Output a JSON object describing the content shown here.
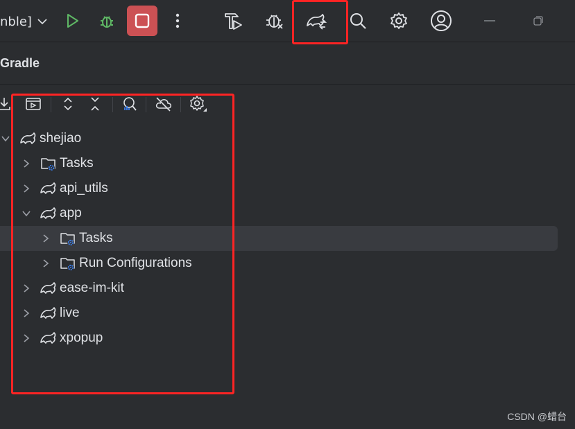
{
  "toolbar": {
    "run_config_label": "nble]",
    "icons": [
      "chevron-down-icon",
      "run-icon",
      "debug-icon",
      "stop-icon",
      "more-icon",
      "build-icon",
      "profile-icon",
      "gradle-sync-icon",
      "search-icon",
      "settings-icon",
      "account-icon",
      "minimize-icon",
      "restore-icon"
    ]
  },
  "panel": {
    "title": "Gradle"
  },
  "gradle_toolbar": {
    "icons": [
      "download-sources-icon",
      "run-task-icon",
      "expand-all-icon",
      "collapse-all-icon",
      "analyze-dependencies-icon",
      "offline-mode-icon",
      "gradle-settings-icon"
    ]
  },
  "tree": {
    "items": [
      {
        "label": "shejiao",
        "type": "gradle-project",
        "expanded": true
      },
      {
        "label": "Tasks",
        "type": "tasks-folder",
        "expanded": false
      },
      {
        "label": "api_utils",
        "type": "gradle-project",
        "expanded": false
      },
      {
        "label": "app",
        "type": "gradle-project",
        "expanded": true
      },
      {
        "label": "Tasks",
        "type": "tasks-folder",
        "expanded": false,
        "selected": true
      },
      {
        "label": "Run Configurations",
        "type": "tasks-folder",
        "expanded": false
      },
      {
        "label": "ease-im-kit",
        "type": "gradle-project",
        "expanded": false
      },
      {
        "label": "live",
        "type": "gradle-project",
        "expanded": false
      },
      {
        "label": "xpopup",
        "type": "gradle-project",
        "expanded": false
      }
    ]
  },
  "colors": {
    "background": "#2b2d30",
    "stop_button": "#cc5154",
    "run_green": "#5fb865",
    "annotation_red": "#ff2424",
    "gear_blue": "#3b82f6"
  },
  "watermark": "CSDN @蜡台"
}
